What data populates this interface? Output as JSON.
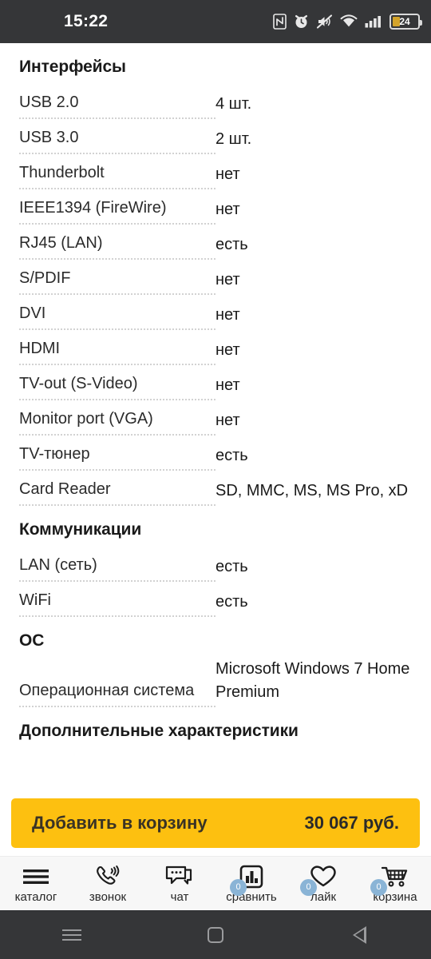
{
  "status_bar": {
    "time": "15:22",
    "battery_percent": "24",
    "icons": [
      "nfc-icon",
      "alarm-icon",
      "mute-icon",
      "wifi-icon",
      "cellular-signal-icon",
      "battery-icon"
    ]
  },
  "spec_sections": [
    {
      "title": "Интерфейсы",
      "rows": [
        {
          "label": "USB 2.0",
          "value": "4 шт."
        },
        {
          "label": "USB 3.0",
          "value": "2 шт."
        },
        {
          "label": "Thunderbolt",
          "value": "нет"
        },
        {
          "label": "IEEE1394 (FireWire)",
          "value": "нет"
        },
        {
          "label": "RJ45 (LAN)",
          "value": "есть"
        },
        {
          "label": "S/PDIF",
          "value": "нет"
        },
        {
          "label": "DVI",
          "value": "нет"
        },
        {
          "label": "HDMI",
          "value": "нет"
        },
        {
          "label": "TV-out (S-Video)",
          "value": "нет"
        },
        {
          "label": "Monitor port (VGA)",
          "value": "нет"
        },
        {
          "label": "TV-тюнер",
          "value": "есть"
        },
        {
          "label": "Card Reader",
          "value": "SD, MMC, MS, MS Pro, xD"
        }
      ]
    },
    {
      "title": "Коммуникации",
      "rows": [
        {
          "label": "LAN (сеть)",
          "value": "есть"
        },
        {
          "label": "WiFi",
          "value": "есть"
        }
      ]
    },
    {
      "title": "ОС",
      "rows": [
        {
          "label": "Операционная система",
          "value": "Microsoft Windows 7 Home Premium"
        }
      ]
    },
    {
      "title": "Дополнительные характеристики",
      "rows": []
    }
  ],
  "cta": {
    "label": "Добавить в корзину",
    "price": "30 067 руб.",
    "background_color": "#fdc010"
  },
  "tabbar": {
    "items": [
      {
        "label": "каталог",
        "icon": "hamburger-menu-icon",
        "badge": null
      },
      {
        "label": "звонок",
        "icon": "phone-call-icon",
        "badge": null
      },
      {
        "label": "чат",
        "icon": "chat-bubble-icon",
        "badge": null
      },
      {
        "label": "сравнить",
        "icon": "compare-bar-chart-icon",
        "badge": "0"
      },
      {
        "label": "лайк",
        "icon": "heart-icon",
        "badge": "0"
      },
      {
        "label": "корзина",
        "icon": "shopping-cart-icon",
        "badge": "0"
      }
    ],
    "badge_color": "#8ab4d6"
  },
  "android_nav": {
    "buttons": [
      "recents-icon",
      "home-icon",
      "back-icon"
    ]
  }
}
